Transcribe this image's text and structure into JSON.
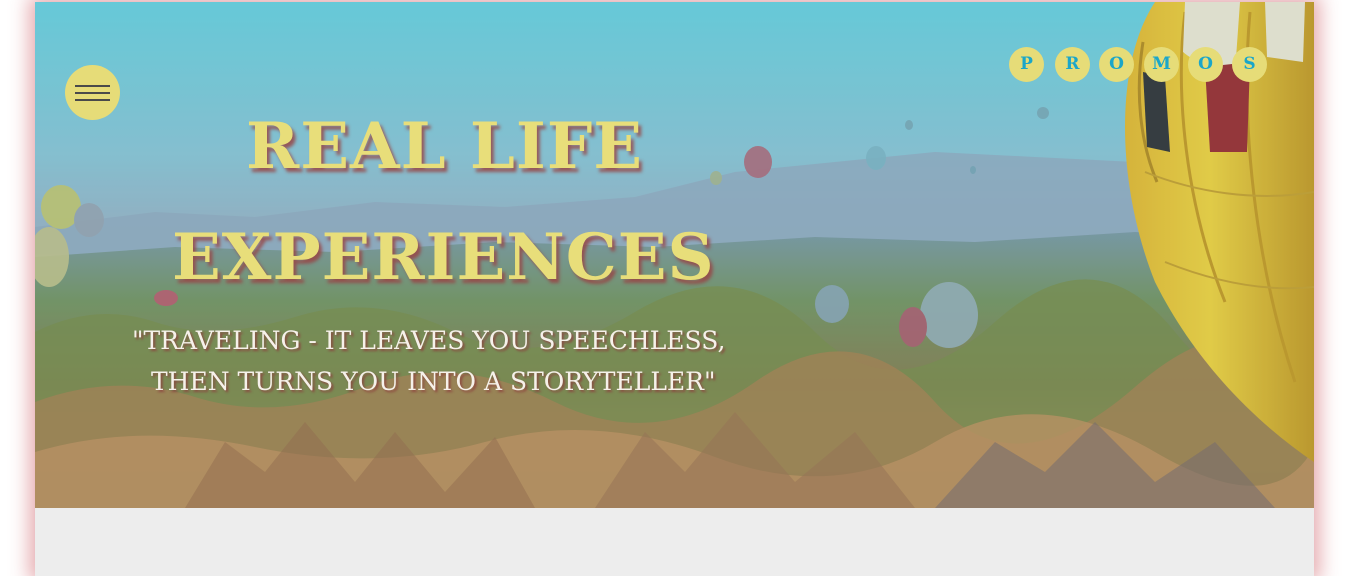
{
  "hero": {
    "title_line1": "REAL LIFE",
    "title_line2": "EXPERIENCES",
    "quote_line1": "\"TRAVELING - IT LEAVES YOU SPEECHLESS,",
    "quote_line2": "THEN TURNS YOU INTO A STORYTELLER\"",
    "background_image": "cappadocia-hot-air-balloons"
  },
  "menu": {
    "icon": "hamburger-menu-icon"
  },
  "promos": {
    "letters": [
      "P",
      "R",
      "O",
      "M",
      "O",
      "S"
    ]
  },
  "colors": {
    "accent_yellow": "#e6dc78",
    "promo_letter": "#1ba6c9",
    "content_background": "#ededed",
    "frame_shadow": "#c84650"
  }
}
